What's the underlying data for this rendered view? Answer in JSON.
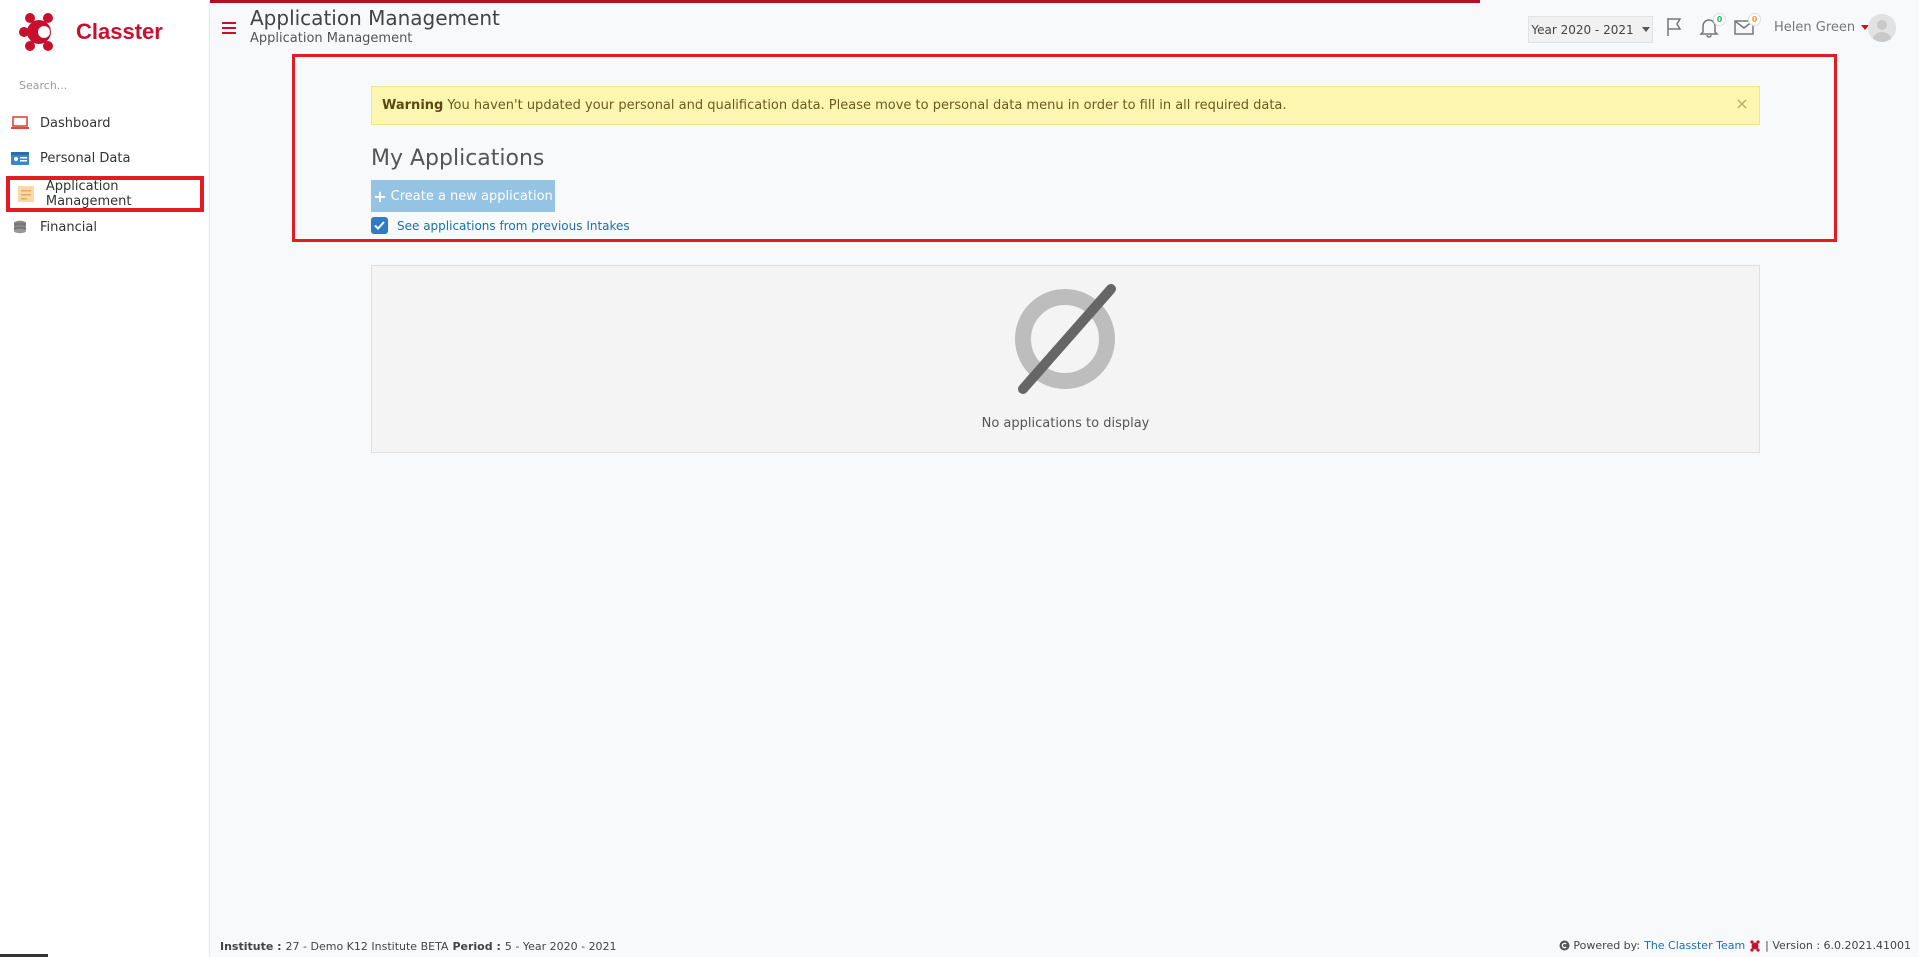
{
  "app": {
    "name": "Classter"
  },
  "sidebar": {
    "search_placeholder": "Search...",
    "items": [
      {
        "label": "Dashboard",
        "icon": "laptop-icon",
        "active": false
      },
      {
        "label": "Personal Data",
        "icon": "id-card-icon",
        "active": false
      },
      {
        "label": "Application Management",
        "icon": "form-icon",
        "active": true
      },
      {
        "label": "Financial",
        "icon": "coins-icon",
        "active": false
      }
    ]
  },
  "header": {
    "title": "Application Management",
    "breadcrumb": "Application Management",
    "year_select": "Year 2020 - 2021",
    "notifications_count": "0",
    "messages_count": "0",
    "user_name": "Helen Green"
  },
  "warning": {
    "label": "Warning",
    "message": "You haven't updated your personal and qualification data. Please move to personal data menu in order to fill in all required data.",
    "close": "×"
  },
  "main": {
    "section_title": "My Applications",
    "create_button": "Create a new application",
    "previous_intakes_label": "See applications from previous Intakes",
    "previous_intakes_checked": true,
    "empty_message": "No applications to display"
  },
  "footer": {
    "institute_label": "Institute :",
    "institute_value": "27 - Demo K12 Institute BETA",
    "period_label": "Period :",
    "period_value": "5 - Year 2020 - 2021",
    "powered_by": "Powered by:",
    "team_link": "The Classter Team",
    "version": "| Version : 6.0.2021.41001"
  },
  "colors": {
    "brand": "#c8102e",
    "highlight_border": "#e31b23",
    "warning_bg": "#fdf6b1",
    "button": "#94c3e3",
    "link": "#1f6fa8"
  }
}
